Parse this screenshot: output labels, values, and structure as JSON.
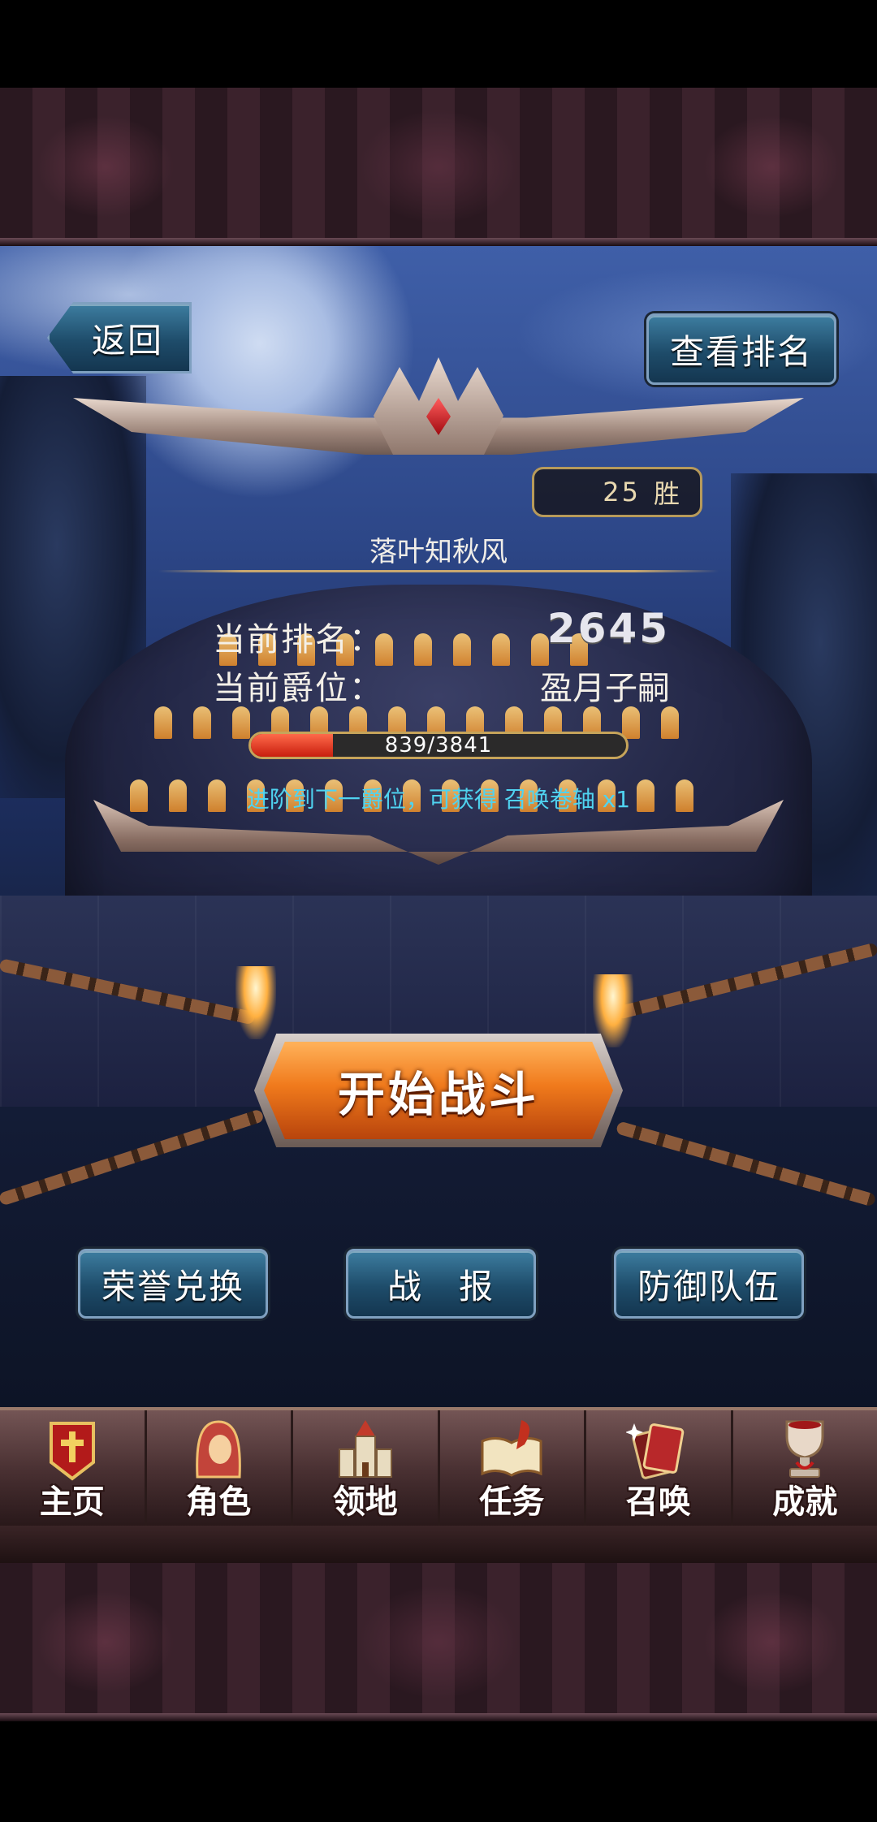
{
  "header": {
    "back_label": "返回",
    "ranking_label": "查看排名",
    "wins_count": "25",
    "wins_unit": "胜",
    "player_name": "落叶知秋风"
  },
  "stats": {
    "rank_label": "当前排名：",
    "rank_value": "2645",
    "title_label": "当前爵位：",
    "title_value": "盈月子嗣"
  },
  "progress": {
    "current": 839,
    "max": 3841,
    "text": "839/3841"
  },
  "reward": {
    "text": "进阶到下一爵位，可获得 召唤卷轴 x1"
  },
  "start_battle_label": "开始战斗",
  "actions": {
    "honor_exchange": "荣誉兑换",
    "battle_report": "战　报",
    "defense_team": "防御队伍"
  },
  "nav": {
    "items": [
      {
        "label": "主页",
        "icon": "banner-cross-icon"
      },
      {
        "label": "角色",
        "icon": "hooded-character-icon"
      },
      {
        "label": "领地",
        "icon": "castle-icon"
      },
      {
        "label": "任务",
        "icon": "book-quill-icon"
      },
      {
        "label": "召唤",
        "icon": "summon-cards-icon"
      },
      {
        "label": "成就",
        "icon": "trophy-icon"
      }
    ]
  },
  "colors": {
    "accent_blue": "#4fd3f0",
    "start_orange": "#f07a1c",
    "progress_red": "#c81e0e",
    "gold_trim": "#c6a45a"
  }
}
